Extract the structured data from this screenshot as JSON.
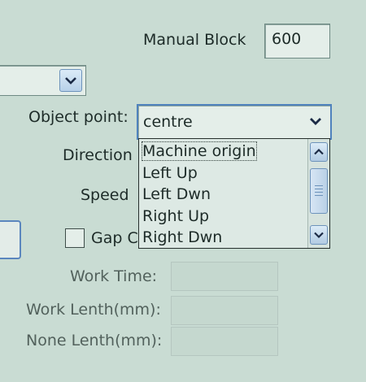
{
  "manual_block": {
    "label": "Manual Block",
    "value": "600"
  },
  "object_point": {
    "label": "Object point:",
    "value": "centre",
    "options": [
      "Machine origin",
      "Left Up",
      "Left Dwn",
      "Right Up",
      "Right Dwn"
    ]
  },
  "direction": {
    "label": "Direction"
  },
  "speed": {
    "label": "Speed"
  },
  "gap": {
    "label": "Gap C"
  },
  "work_time": {
    "label": "Work Time:"
  },
  "work_length": {
    "label": "Work Lenth(mm):"
  },
  "none_length": {
    "label": "None Lenth(mm):"
  },
  "colors": {
    "background": "#c9dcd3",
    "accent": "#4f82bd"
  },
  "icons": {
    "dropdown": "chevron-down-icon",
    "scroll_up": "chevron-up-icon",
    "scroll_down": "chevron-down-icon"
  }
}
